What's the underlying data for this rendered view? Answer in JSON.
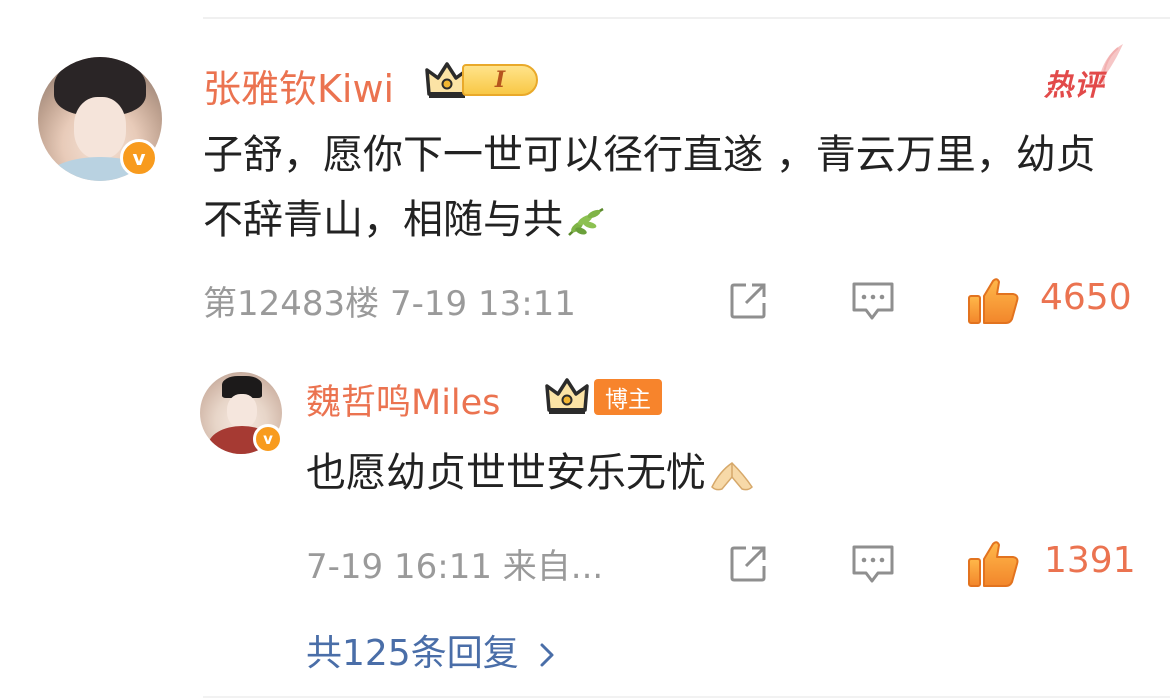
{
  "comment": {
    "username": "张雅钦Kiwi",
    "level_badge": "I",
    "hot_label": "热评",
    "text": "子舒，愿你下一世可以径行直遂 ，青云万里，幼贞不辞青山，相随与共",
    "emoji": "leaf-emoji",
    "floor": "第12483楼",
    "timestamp": "7-19 13:11",
    "likes": "4650"
  },
  "reply": {
    "username": "魏哲鸣Miles",
    "role_badge": "博主",
    "text": "也愿幼贞世世安乐无忧",
    "emoji": "pray-hands-emoji",
    "timestamp": "7-19 16:11",
    "source": "来自...",
    "likes": "1391"
  },
  "more_replies": {
    "label": "共125条回复"
  },
  "icons": {
    "share": "share-icon",
    "comment": "comment-icon",
    "like": "thumbs-up-icon",
    "verified": "verified-icon",
    "crown": "crown-icon",
    "chevron": "chevron-right-icon"
  },
  "colors": {
    "username": "#eb7350",
    "meta_gray": "#9a9a9a",
    "link_blue": "#4a6ea8",
    "verified_orange": "#f89b1e",
    "hot_red": "#e24a4a",
    "blogger_orange": "#f7842c"
  }
}
